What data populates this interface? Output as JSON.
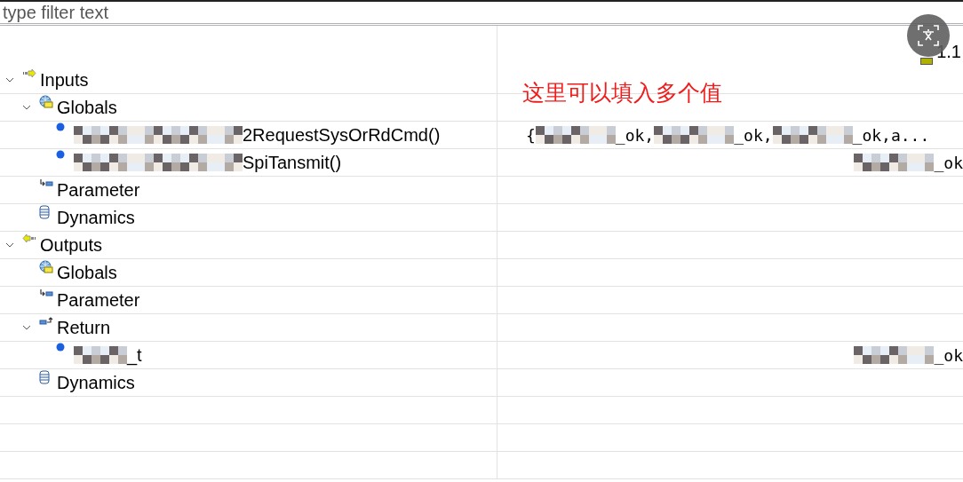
{
  "filter": {
    "placeholder": "type filter text"
  },
  "header_value": "1.1",
  "annotation": "这里可以填入多个值",
  "tree": [
    {
      "kind": "inputs",
      "label": [
        {
          "kind": "text",
          "text": "Inputs"
        }
      ],
      "expanded": true,
      "children": [
        {
          "kind": "globals",
          "label": [
            {
              "kind": "text",
              "text": "Globals"
            }
          ],
          "expanded": true,
          "children": [
            {
              "kind": "variable",
              "label": [
                {
                  "kind": "redacted-long"
                },
                {
                  "kind": "text",
                  "text": "2RequestSysOrRdCmd()"
                }
              ],
              "value_right_aligned": false,
              "value": [
                {
                  "kind": "text",
                  "text": "{"
                },
                {
                  "kind": "redacted-medium"
                },
                {
                  "kind": "text",
                  "text": "_ok,"
                },
                {
                  "kind": "redacted-medium"
                },
                {
                  "kind": "text",
                  "text": "_ok,"
                },
                {
                  "kind": "redacted-medium"
                },
                {
                  "kind": "text",
                  "text": "_ok,a..."
                }
              ]
            },
            {
              "kind": "variable",
              "label": [
                {
                  "kind": "redacted-long"
                },
                {
                  "kind": "text",
                  "text": "SpiTansmit()"
                }
              ],
              "value_right_aligned": true,
              "value": [
                {
                  "kind": "redacted-medium"
                },
                {
                  "kind": "text",
                  "text": "_ok"
                }
              ]
            }
          ]
        },
        {
          "kind": "parameter",
          "label": [
            {
              "kind": "text",
              "text": "Parameter"
            }
          ]
        },
        {
          "kind": "dynamics",
          "label": [
            {
              "kind": "text",
              "text": "Dynamics"
            }
          ]
        }
      ]
    },
    {
      "kind": "outputs",
      "label": [
        {
          "kind": "text",
          "text": "Outputs"
        }
      ],
      "expanded": true,
      "children": [
        {
          "kind": "globals",
          "label": [
            {
              "kind": "text",
              "text": "Globals"
            }
          ]
        },
        {
          "kind": "parameter",
          "label": [
            {
              "kind": "text",
              "text": "Parameter"
            }
          ]
        },
        {
          "kind": "return",
          "label": [
            {
              "kind": "text",
              "text": "Return"
            }
          ],
          "expanded": true,
          "children": [
            {
              "kind": "variable",
              "label": [
                {
                  "kind": "redacted-short"
                },
                {
                  "kind": "text",
                  "text": "_t"
                }
              ],
              "value_right_aligned": true,
              "value": [
                {
                  "kind": "redacted-medium"
                },
                {
                  "kind": "text",
                  "text": "_ok"
                }
              ]
            }
          ]
        },
        {
          "kind": "dynamics",
          "label": [
            {
              "kind": "text",
              "text": "Dynamics"
            }
          ]
        }
      ]
    }
  ]
}
